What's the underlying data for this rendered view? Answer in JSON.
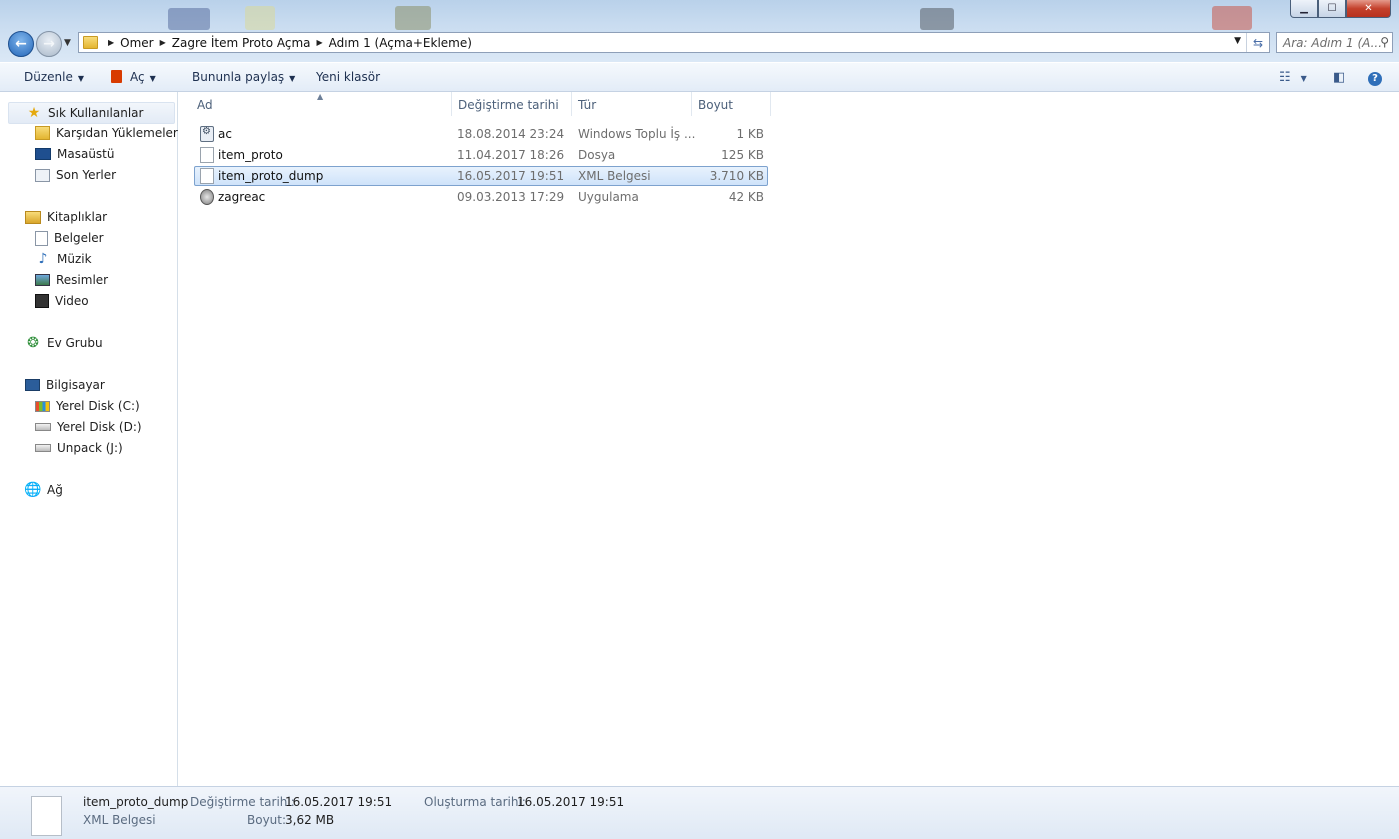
{
  "window": {
    "controls": {
      "minimize": "▁",
      "maximize": "☐",
      "close": "✕"
    }
  },
  "address": {
    "breadcrumbs": [
      "Omer",
      "Zagre İtem Proto Açma",
      "Adım 1 (Açma+Ekleme)"
    ]
  },
  "search": {
    "placeholder": "Ara: Adım 1 (A..."
  },
  "toolbar": {
    "organize_label": "Düzenle",
    "open_label": "Aç",
    "share_label": "Bununla paylaş",
    "new_folder_label": "Yeni klasör"
  },
  "sidebar": {
    "favorites": {
      "label": "Sık Kullanılanlar",
      "items": [
        {
          "label": "Karşıdan Yüklemeler",
          "icon": "downloads-icon"
        },
        {
          "label": "Masaüstü",
          "icon": "desktop-icon"
        },
        {
          "label": "Son Yerler",
          "icon": "recent-places-icon"
        }
      ]
    },
    "libraries": {
      "label": "Kitaplıklar",
      "items": [
        {
          "label": "Belgeler",
          "icon": "documents-icon"
        },
        {
          "label": "Müzik",
          "icon": "music-icon"
        },
        {
          "label": "Resimler",
          "icon": "pictures-icon"
        },
        {
          "label": "Video",
          "icon": "video-icon"
        }
      ]
    },
    "homegroup": {
      "label": "Ev Grubu"
    },
    "computer": {
      "label": "Bilgisayar",
      "items": [
        {
          "label": "Yerel Disk (C:)",
          "icon": "windows-drive-icon"
        },
        {
          "label": "Yerel Disk (D:)",
          "icon": "drive-icon"
        },
        {
          "label": "Unpack (J:)",
          "icon": "drive-icon"
        }
      ]
    },
    "network": {
      "label": "Ağ"
    }
  },
  "columns": {
    "name": "Ad",
    "modified": "Değiştirme tarihi",
    "type": "Tür",
    "size": "Boyut"
  },
  "files": [
    {
      "name": "ac",
      "modified": "18.08.2014 23:24",
      "type": "Windows Toplu İş ...",
      "size": "1 KB",
      "icon": "batch-file-icon"
    },
    {
      "name": "item_proto",
      "modified": "11.04.2017 18:26",
      "type": "Dosya",
      "size": "125 KB",
      "icon": "file-icon"
    },
    {
      "name": "item_proto_dump",
      "modified": "16.05.2017 19:51",
      "type": "XML Belgesi",
      "size": "3.710 KB",
      "icon": "xml-file-icon",
      "selected": true
    },
    {
      "name": "zagreac",
      "modified": "09.03.2013 17:29",
      "type": "Uygulama",
      "size": "42 KB",
      "icon": "application-icon"
    }
  ],
  "details": {
    "name": "item_proto_dump",
    "type": "XML Belgesi",
    "modified_label": "Değiştirme tarihi:",
    "modified_value": "16.05.2017 19:51",
    "size_label": "Boyut:",
    "size_value": "3,62 MB",
    "created_label": "Oluşturma tarihi:",
    "created_value": "16.05.2017 19:51"
  },
  "colors": {
    "selection_fill": "#cfe3fa",
    "selection_border": "#7da2ce",
    "header_text": "#4c607a",
    "chrome": "#c9dcf0"
  }
}
